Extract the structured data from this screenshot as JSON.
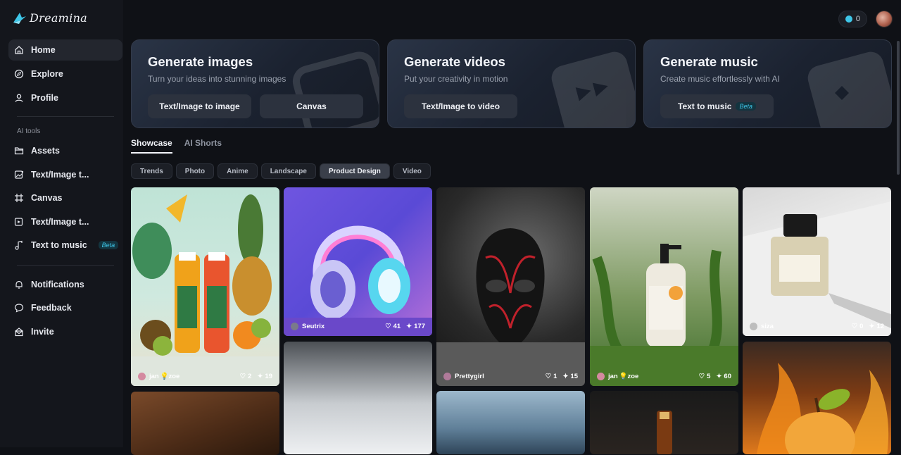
{
  "app": {
    "name": "Dreamina"
  },
  "nav": {
    "home": "Home",
    "explore": "Explore",
    "profile": "Profile",
    "ai_tools_label": "AI tools",
    "assets": "Assets",
    "text_image_1": "Text/Image t...",
    "canvas": "Canvas",
    "text_image_2": "Text/Image t...",
    "text_to_music": "Text to music",
    "beta": "Beta",
    "notifications": "Notifications",
    "feedback": "Feedback",
    "invite": "Invite"
  },
  "header": {
    "credits": "0"
  },
  "cards": [
    {
      "title": "Generate images",
      "subtitle": "Turn your ideas into stunning images",
      "buttons": [
        "Text/Image to image",
        "Canvas"
      ]
    },
    {
      "title": "Generate videos",
      "subtitle": "Put your creativity in motion",
      "buttons": [
        "Text/Image to video"
      ]
    },
    {
      "title": "Generate music",
      "subtitle": "Create music effortlessly with AI",
      "buttons": [
        "Text to music"
      ],
      "badge": "Beta"
    }
  ],
  "tabs": [
    "Showcase",
    "AI Shorts"
  ],
  "chips": [
    "Trends",
    "Photo",
    "Anime",
    "Landscape",
    "Product Design",
    "Video"
  ],
  "active_chip": "Product Design",
  "gallery": [
    {
      "user": "jan 💡zoe",
      "likes": "2",
      "remixes": "19"
    },
    {
      "user": "Seutrix",
      "likes": "41",
      "remixes": "177"
    },
    {
      "user": "Prettygirl",
      "likes": "1",
      "remixes": "15"
    },
    {
      "user": "jan 💡zoe",
      "likes": "5",
      "remixes": "60"
    },
    {
      "user": "siza",
      "likes": "0",
      "remixes": "12"
    }
  ],
  "colors": {
    "accent": "#3ec6e8",
    "background": "#0f1116",
    "sidebar": "#14161c"
  }
}
